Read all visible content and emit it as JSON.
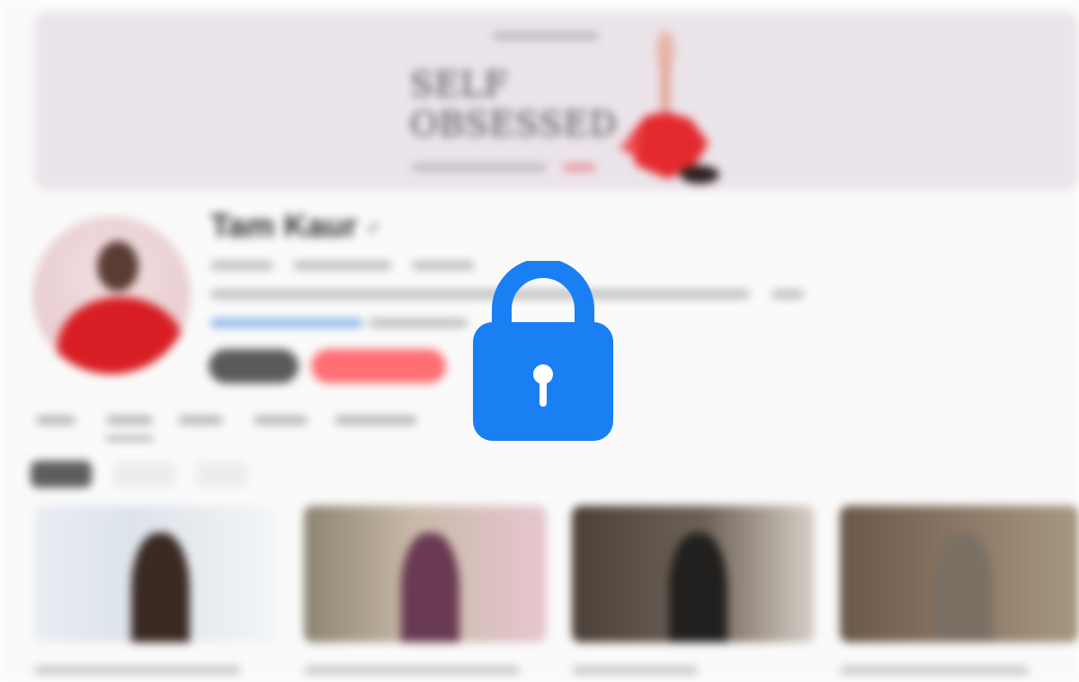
{
  "channel": {
    "name": "Tam Kaur",
    "verified_mark": "✓"
  },
  "banner": {
    "title_line1": "SELF",
    "title_line2": "OBSESSED"
  },
  "overlay": {
    "icon": "lock-icon",
    "color": "#1a7ff2"
  },
  "colors": {
    "subscribe_button": "#ff6e73",
    "dark_button": "#5a5a5a",
    "banner_background": "#ebe4ea"
  }
}
